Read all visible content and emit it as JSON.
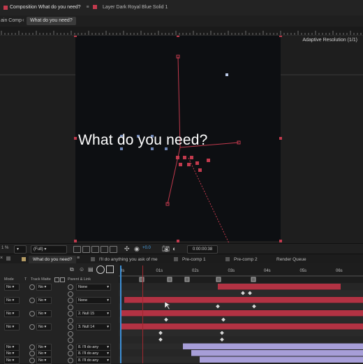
{
  "top_tabs": {
    "composition_tab": "Composition What do you need?",
    "composition_menu_glyph": "≡",
    "layer_tab": "Layer Dark Royal Blue Solid 1"
  },
  "breadcrumbs": [
    "ain Comp",
    "What do you need?"
  ],
  "breadcrumb_arrow": "‹",
  "viewer": {
    "adaptive_resolution": "Adaptive Resolution (1/1)",
    "composition_text": "What do you need?"
  },
  "viewer_toolbar": {
    "zoom_label": "1 %",
    "resolution": "(Full)",
    "exposure_value": "+0.0",
    "timecode": "0:00:00:38"
  },
  "timeline_tabs": [
    {
      "label": "What do you need?",
      "active": true
    },
    {
      "label": "I'll do anything you ask of me",
      "active": false
    },
    {
      "label": "Pre-comp 1",
      "active": false
    },
    {
      "label": "Pre-comp 2",
      "active": false
    },
    {
      "label": "Render Queue",
      "active": false
    }
  ],
  "timeline_tab_close": "×",
  "column_headers": {
    "mode": "Mode",
    "t": "T",
    "track_matte": "Track Matte",
    "parent_link": "Parent & Link"
  },
  "time_ruler_labels": [
    "0s",
    "01s",
    "02s",
    "03s",
    "04s",
    "05s",
    "06s"
  ],
  "layers": [
    {
      "mode": "No",
      "matte": "No",
      "parent": "None"
    },
    {
      "mode": "",
      "matte": "",
      "parent": ""
    },
    {
      "mode": "No",
      "matte": "No",
      "parent": "None"
    },
    {
      "mode": "",
      "matte": "",
      "parent": ""
    },
    {
      "mode": "No",
      "matte": "No",
      "parent": "2. Null 15"
    },
    {
      "mode": "",
      "matte": "",
      "parent": ""
    },
    {
      "mode": "No",
      "matte": "No",
      "parent": "3. Null 14"
    },
    {
      "mode": "",
      "matte": "",
      "parent": ""
    },
    {
      "mode": "",
      "matte": "",
      "parent": ""
    },
    {
      "mode": "No",
      "matte": "No",
      "parent": "8. I'll do any"
    },
    {
      "mode": "No",
      "matte": "No",
      "parent": "8. I'll do any"
    },
    {
      "mode": "No",
      "matte": "No",
      "parent": "8. I'll do any"
    }
  ],
  "colors": {
    "accent_red": "#b23243",
    "purple_bar": "#a79ed8",
    "cti_blue": "#3d8fd6"
  },
  "icons": [
    "chevron-down-icon",
    "eye-icon",
    "spiral-icon",
    "camera-icon",
    "grid-icon",
    "close-icon",
    "menu-icon"
  ]
}
